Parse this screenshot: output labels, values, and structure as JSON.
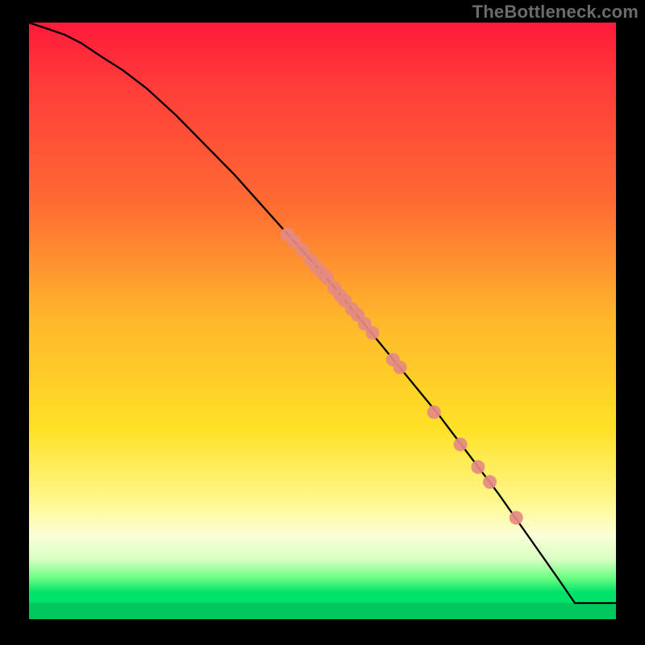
{
  "attribution": "TheBottleneck.com",
  "chart_data": {
    "type": "line",
    "title": "",
    "xlabel": "",
    "ylabel": "",
    "xlim": [
      0,
      100
    ],
    "ylim": [
      0,
      100
    ],
    "grid": false,
    "legend": false,
    "series": [
      {
        "name": "curve",
        "x": [
          0,
          3,
          6,
          9,
          12,
          16,
          20,
          25,
          30,
          35,
          40,
          45,
          50,
          55,
          60,
          65,
          70,
          75,
          80,
          85,
          90,
          93,
          100
        ],
        "y": [
          100,
          99,
          98,
          96.5,
          94.5,
          92,
          89,
          84.5,
          79.5,
          74.5,
          69,
          63.5,
          58,
          52,
          46,
          40,
          34,
          27.5,
          21,
          14,
          7,
          2.7,
          2.7
        ]
      }
    ],
    "points": {
      "name": "markers",
      "color": "#e58a83",
      "xy": [
        [
          44,
          64.5
        ],
        [
          45.2,
          63.3
        ],
        [
          46.6,
          61.8
        ],
        [
          48,
          60.2
        ],
        [
          49,
          59
        ],
        [
          50,
          58
        ],
        [
          50.8,
          57.2
        ],
        [
          52,
          55.5
        ],
        [
          53,
          54.3
        ],
        [
          53.8,
          53.4
        ],
        [
          55,
          52
        ],
        [
          56,
          51
        ],
        [
          57.2,
          49.5
        ],
        [
          58.5,
          48
        ],
        [
          62,
          43.5
        ],
        [
          63.2,
          42.2
        ],
        [
          69,
          34.7
        ],
        [
          73.5,
          29.3
        ],
        [
          76.5,
          25.5
        ],
        [
          78.5,
          23
        ],
        [
          83,
          17
        ]
      ]
    }
  }
}
